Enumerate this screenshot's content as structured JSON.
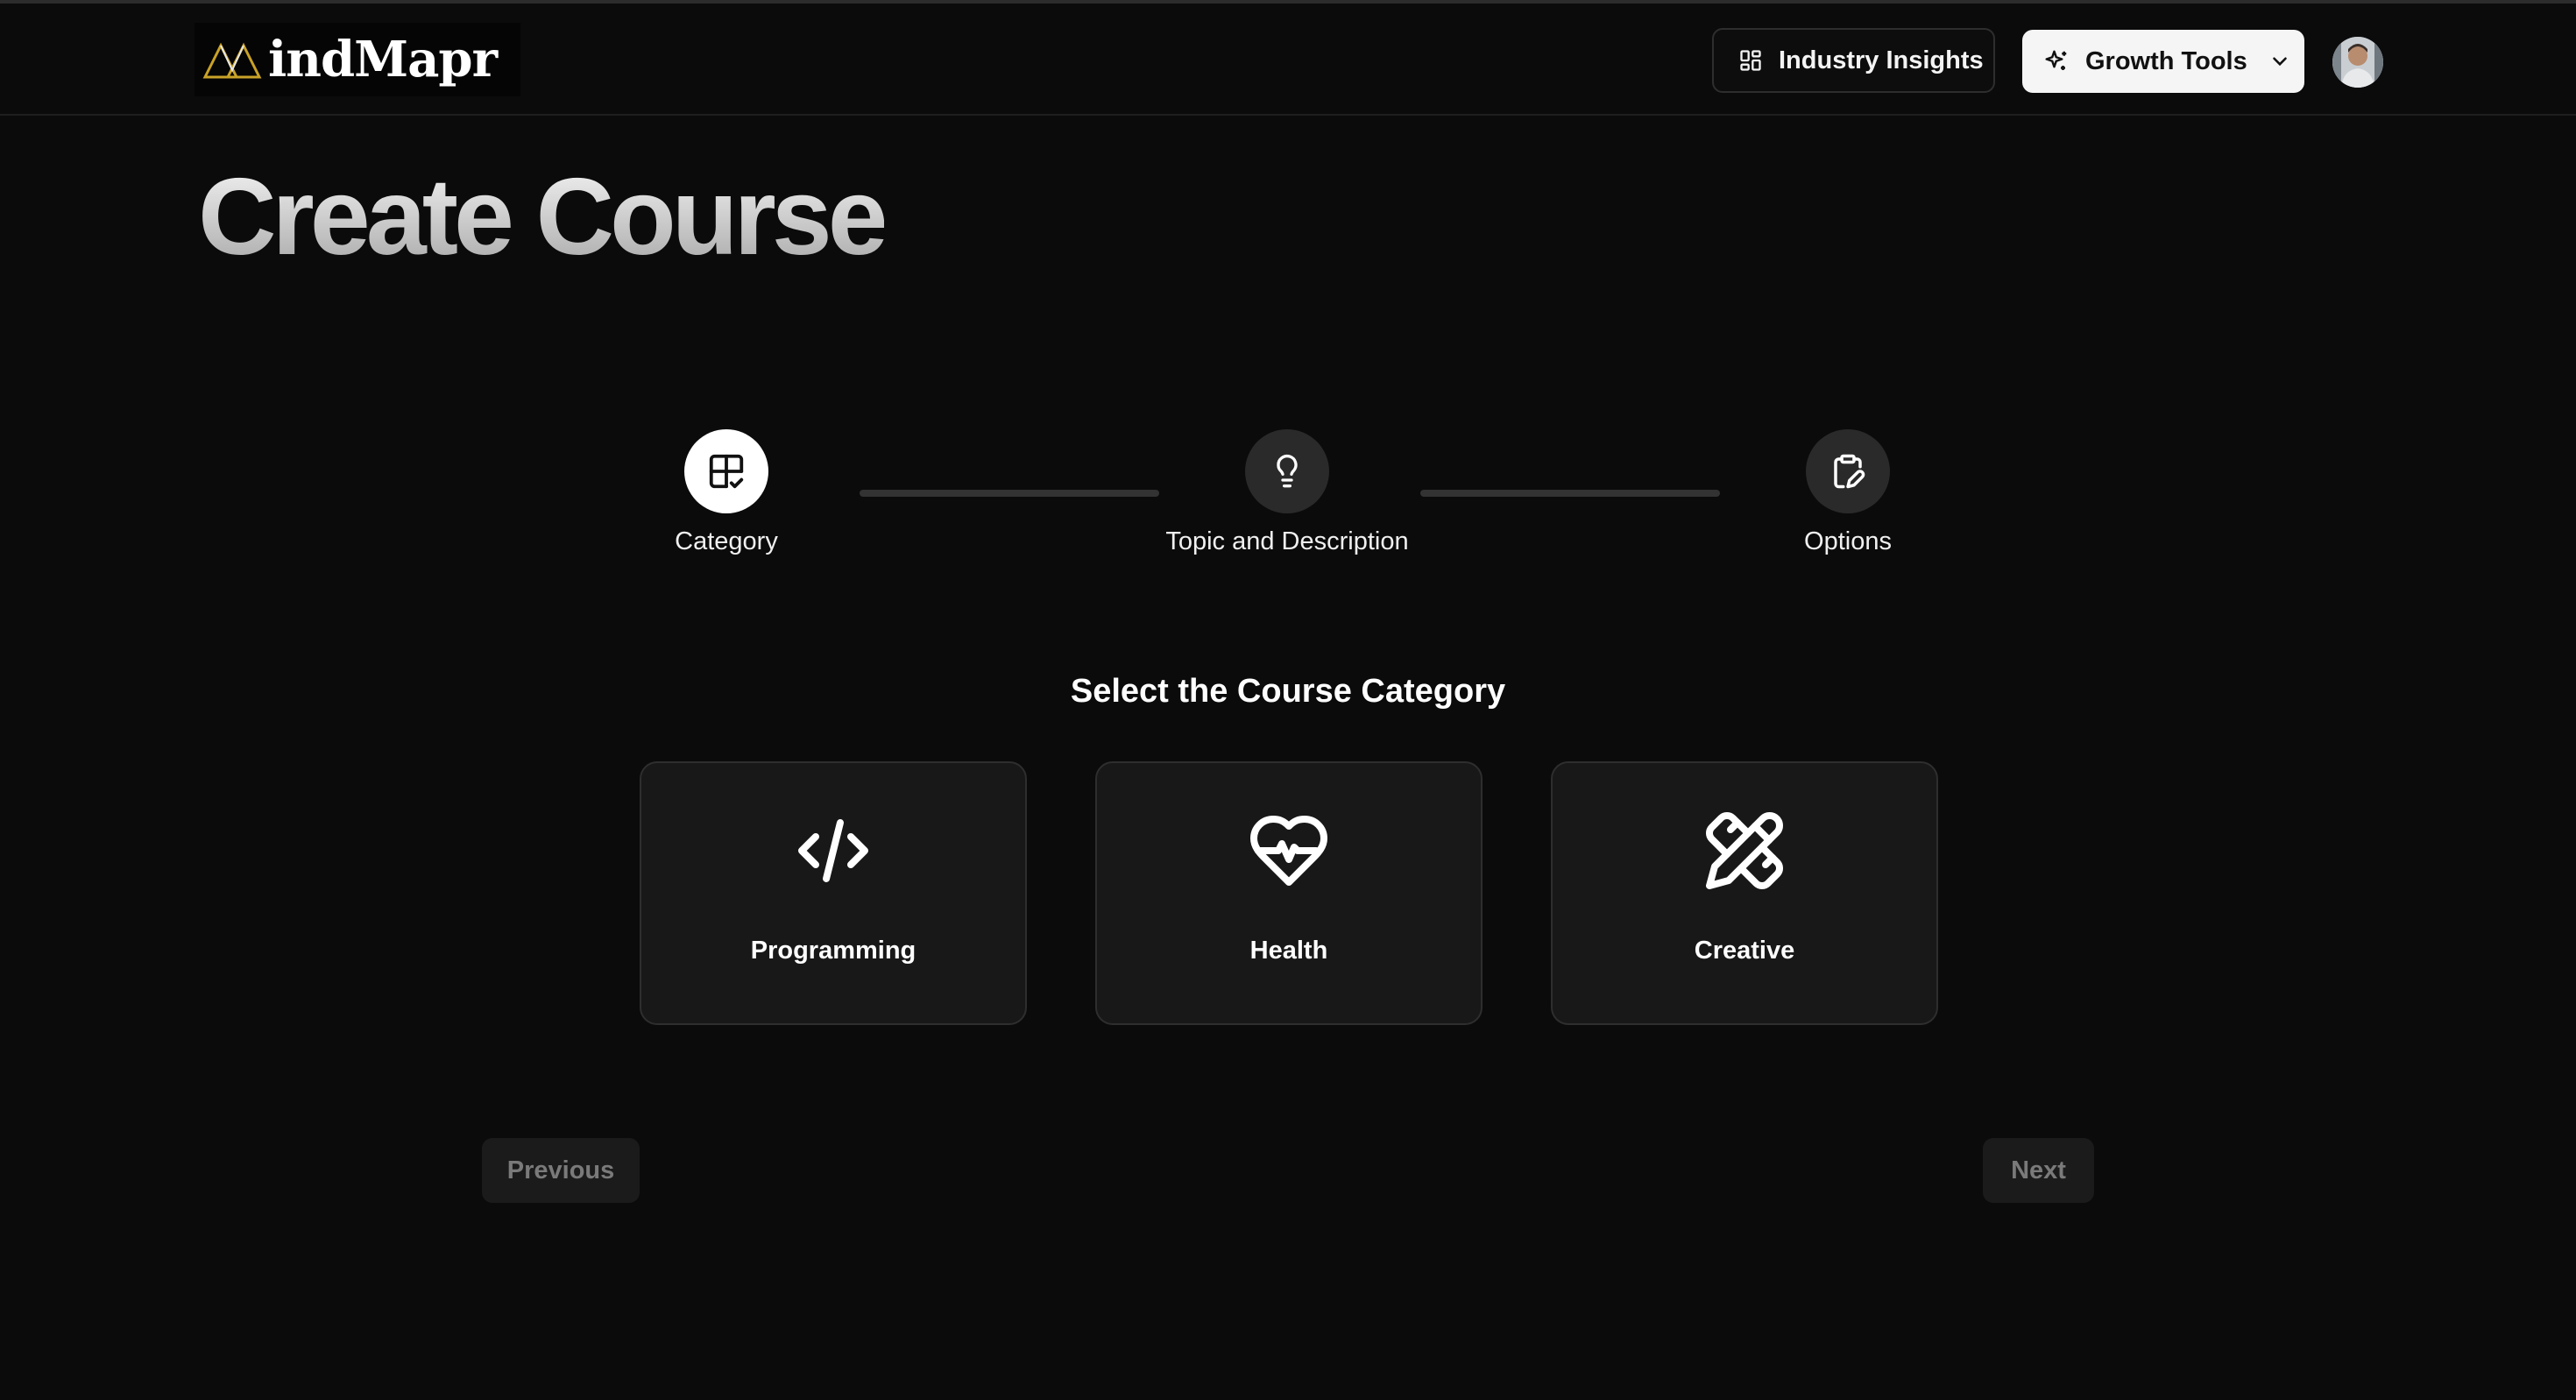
{
  "header": {
    "logo_text": "indMapr",
    "industry_insights_label": "Industry Insights",
    "growth_tools_label": "Growth Tools"
  },
  "page": {
    "title": "Create Course"
  },
  "stepper": {
    "steps": [
      {
        "label": "Category",
        "icon": "layout-grid-check-icon",
        "active": true
      },
      {
        "label": "Topic and Description",
        "icon": "lightbulb-icon",
        "active": false
      },
      {
        "label": "Options",
        "icon": "clipboard-edit-icon",
        "active": false
      }
    ]
  },
  "category": {
    "title": "Select the Course Category",
    "items": [
      {
        "label": "Programming",
        "icon": "code-icon"
      },
      {
        "label": "Health",
        "icon": "heart-pulse-icon"
      },
      {
        "label": "Creative",
        "icon": "pencil-ruler-icon"
      }
    ]
  },
  "navigation": {
    "previous_label": "Previous",
    "next_label": "Next"
  },
  "colors": {
    "background": "#0b0b0b",
    "card": "#181818",
    "accent_logo": "#c9a227",
    "button_light": "#f5f5f5"
  }
}
